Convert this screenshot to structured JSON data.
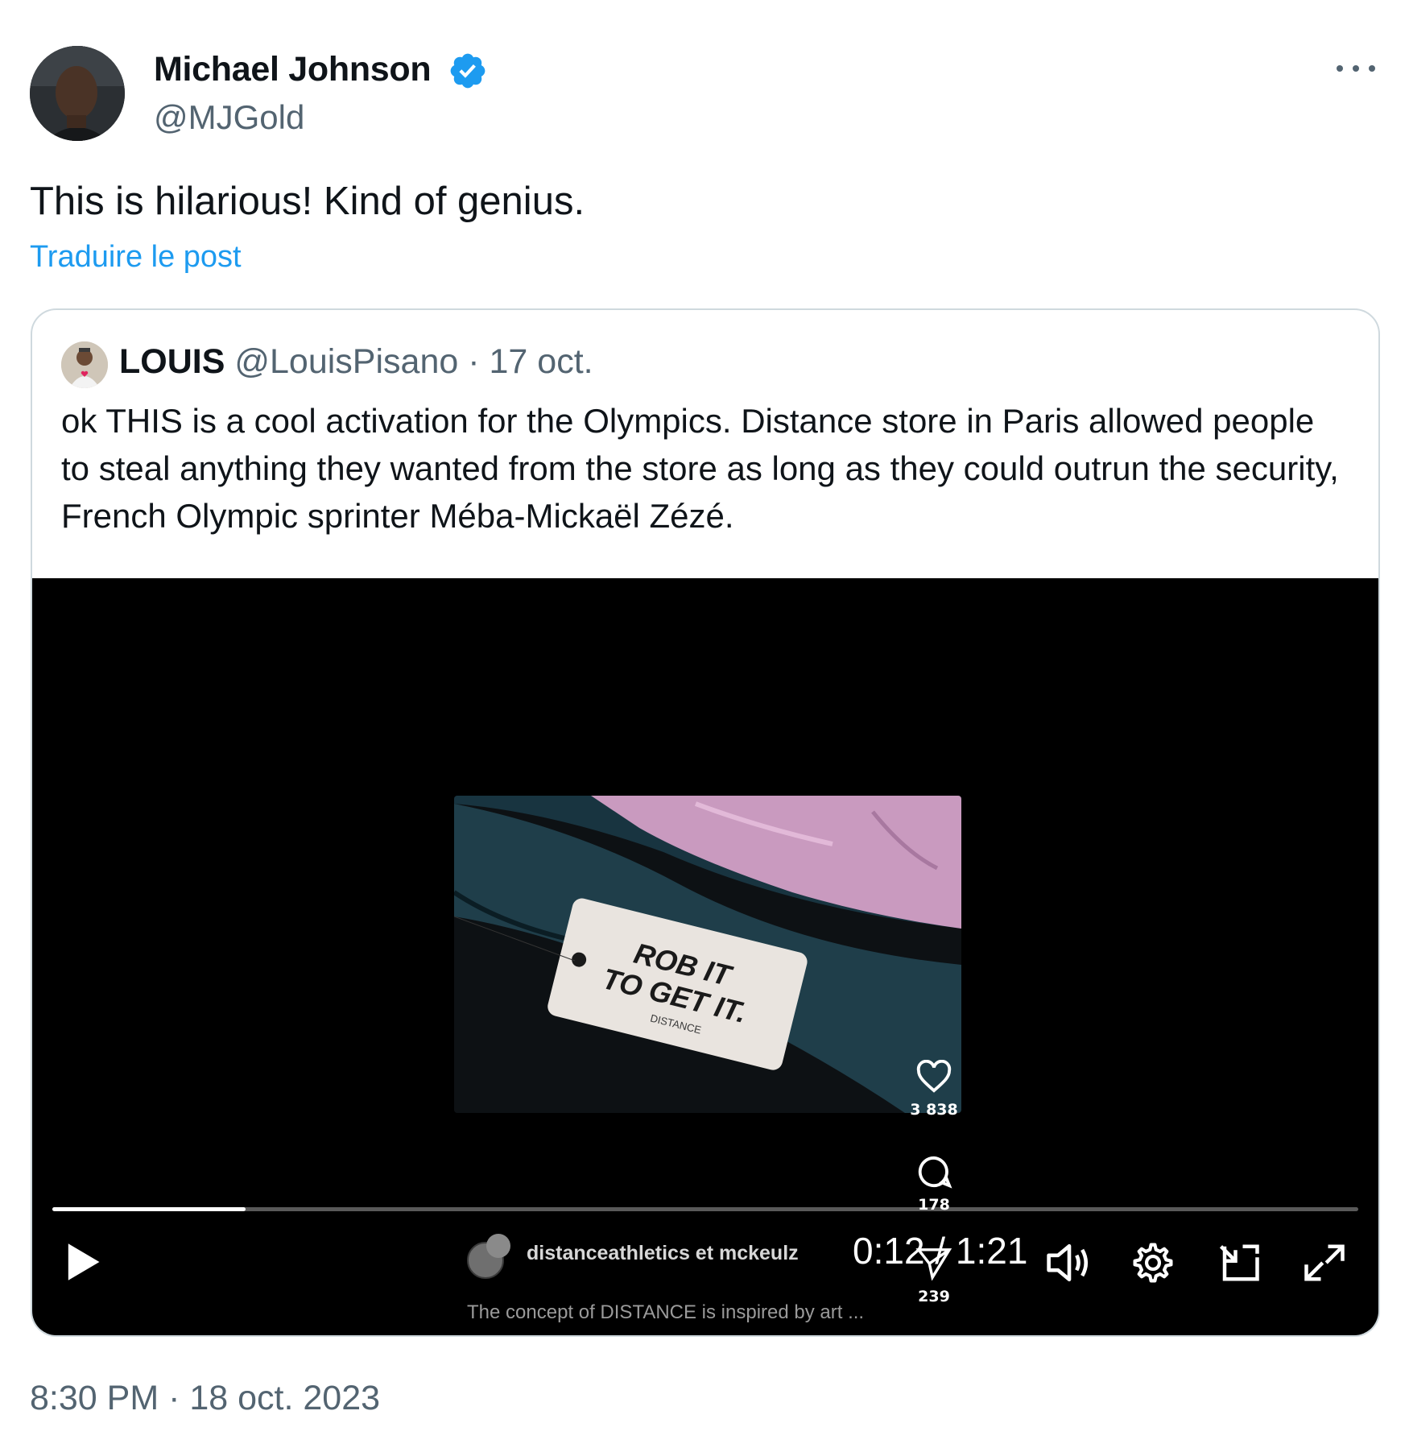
{
  "author": {
    "name": "Michael Johnson",
    "handle": "@MJGold",
    "verified": true
  },
  "post": {
    "text": "This is hilarious! Kind of genius.",
    "translate_label": "Traduire le post",
    "timestamp": "8:30 PM · 18 oct. 2023"
  },
  "quote": {
    "name": "LOUIS",
    "meta": "@LouisPisano · 17 oct.",
    "text": "ok THIS is a cool activation for the Olympics. Distance store in Paris allowed people to steal anything they wanted from the store as long as they could outrun the security, French Olympic sprinter Méba-Mickaël Zézé."
  },
  "video": {
    "thumbnail_tag_text": [
      "ROB IT",
      "TO GET IT.",
      "DISTANCE"
    ],
    "side_actions": [
      {
        "icon": "heart-icon",
        "count": "3 838"
      },
      {
        "icon": "comment-icon",
        "count": "178"
      },
      {
        "icon": "send-icon",
        "count": "239"
      }
    ],
    "overlay_user": "distanceathletics et mckeulz",
    "overlay_caption": "The concept of DISTANCE is inspired by art ...",
    "current_time": "0:12",
    "duration": "1:21",
    "time_display": "0:12 / 1:21",
    "progress_fraction": 0.148,
    "controls": [
      "play-icon",
      "volume-icon",
      "settings-icon",
      "pip-icon",
      "fullscreen-icon"
    ]
  },
  "colors": {
    "accent": "#1d9bf0",
    "secondary_text": "#536471",
    "border": "#cfd9de"
  }
}
